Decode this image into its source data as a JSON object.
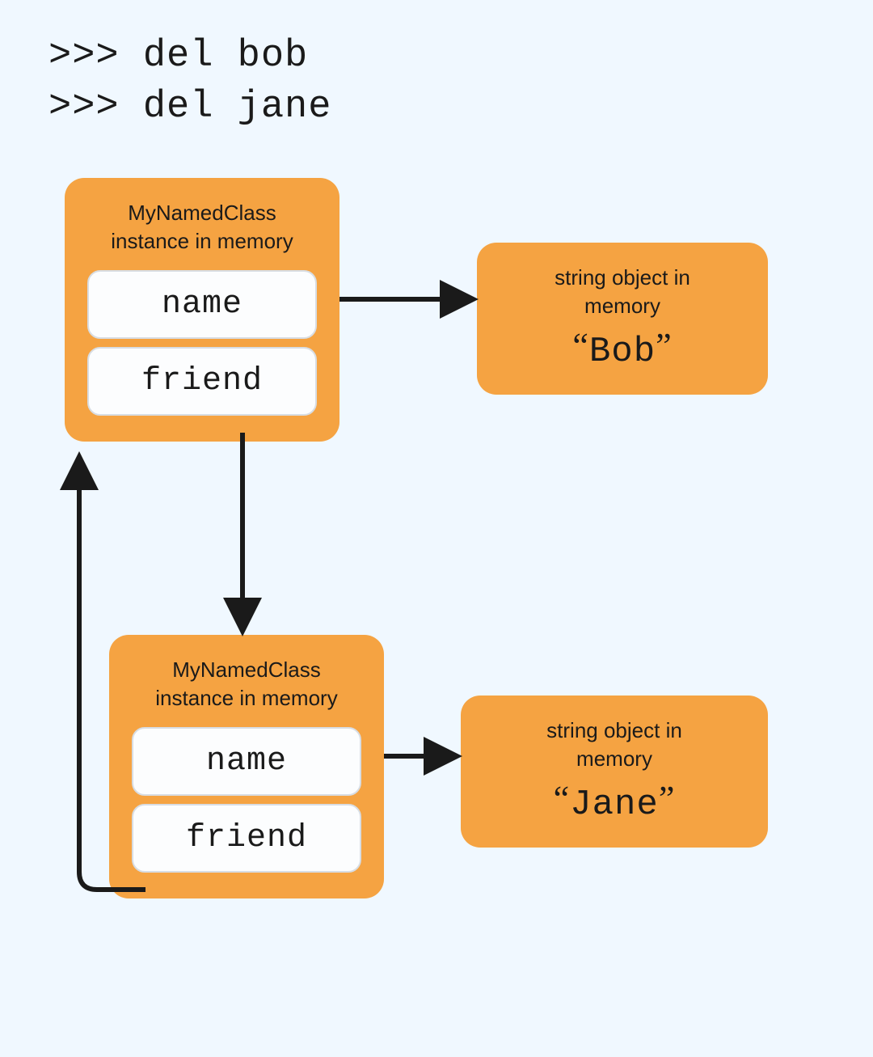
{
  "code": {
    "line1": ">>> del bob",
    "line2": ">>> del jane"
  },
  "instances": [
    {
      "title_line1": "MyNamedClass",
      "title_line2": "instance in memory",
      "attrs": {
        "name": "name",
        "friend": "friend"
      }
    },
    {
      "title_line1": "MyNamedClass",
      "title_line2": "instance in memory",
      "attrs": {
        "name": "name",
        "friend": "friend"
      }
    }
  ],
  "strings": [
    {
      "title_line1": "string object in",
      "title_line2": "memory",
      "value": "Bob"
    },
    {
      "title_line1": "string object in",
      "title_line2": "memory",
      "value": "Jane"
    }
  ]
}
